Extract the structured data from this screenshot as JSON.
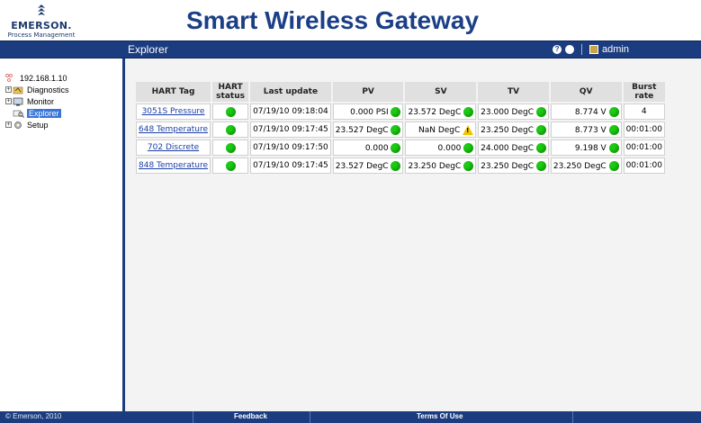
{
  "header": {
    "logo_brand": "EMERSON.",
    "logo_sub": "Process Management",
    "title": "Smart Wireless Gateway"
  },
  "topbar": {
    "section": "Explorer",
    "user": "admin"
  },
  "tree": {
    "root": "192.168.1.10",
    "items": [
      {
        "label": "Diagnostics"
      },
      {
        "label": "Monitor"
      },
      {
        "label": "Explorer"
      },
      {
        "label": "Setup"
      }
    ]
  },
  "table": {
    "headers": [
      "HART Tag",
      "HART status",
      "Last update",
      "PV",
      "SV",
      "TV",
      "QV",
      "Burst rate"
    ],
    "rows": [
      {
        "tag": "3051S Pressure",
        "last": "07/19/10 09:18:04",
        "pv": "0.000 PSI",
        "sv": "23.572 DegC",
        "tv": "23.000 DegC",
        "qv": "8.774 V",
        "burst": "4",
        "sv_status": "ok"
      },
      {
        "tag": "648 Temperature",
        "last": "07/19/10 09:17:45",
        "pv": "23.527 DegC",
        "sv": "NaN DegC",
        "tv": "23.250 DegC",
        "qv": "8.773 V",
        "burst": "00:01:00",
        "sv_status": "warn"
      },
      {
        "tag": "702 Discrete",
        "last": "07/19/10 09:17:50",
        "pv": "0.000",
        "sv": "0.000",
        "tv": "24.000 DegC",
        "qv": "9.198 V",
        "burst": "00:01:00",
        "sv_status": "ok"
      },
      {
        "tag": "848 Temperature",
        "last": "07/19/10 09:17:45",
        "pv": "23.527 DegC",
        "sv": "23.250 DegC",
        "tv": "23.250 DegC",
        "qv": "23.250 DegC",
        "burst": "00:01:00",
        "sv_status": "ok"
      }
    ]
  },
  "footer": {
    "copyright": "© Emerson, 2010",
    "feedback": "Feedback",
    "terms": "Terms Of Use"
  },
  "colors": {
    "nav_blue": "#1c3c80",
    "title_blue": "#1b3f86",
    "status_green": "#1ccc12",
    "warning_yellow": "#f0c400"
  }
}
